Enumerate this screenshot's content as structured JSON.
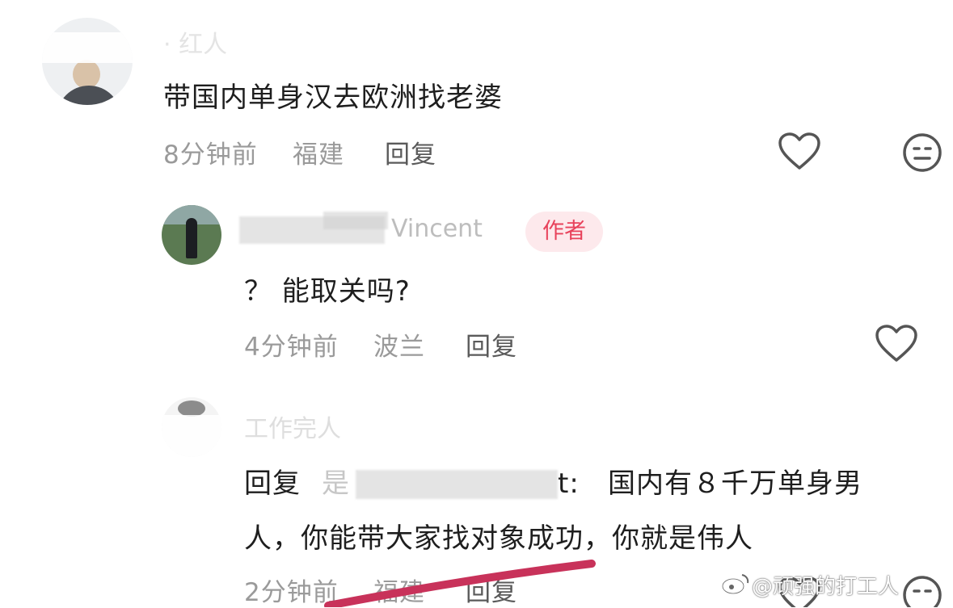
{
  "comments": [
    {
      "author": "· 红人",
      "text": "带国内单身汉去欧洲找老婆",
      "time": "8分钟前",
      "location": "福建",
      "reply_label": "回复"
    },
    {
      "author": "Vincent",
      "author_badge": "作者",
      "text": "？ 能取关吗?",
      "time": "4分钟前",
      "location": "波兰",
      "reply_label": "回复"
    },
    {
      "author": "工作完人",
      "reply_prefix": "回复",
      "reply_target": "是",
      "reply_target_tail": "t:",
      "text_line1": "国内有８千万单身男",
      "text_line2": "人，你能带大家找对象成功，你就是伟人",
      "time": "2分钟前",
      "location": "福建",
      "reply_label": "回复"
    }
  ],
  "watermark": "@顽强的打工人",
  "colors": {
    "badge_text": "#e8425b",
    "badge_bg": "#fde9ec",
    "red_stroke": "#c8325a"
  },
  "icons": [
    "heart-outline-icon",
    "dislike-face-icon",
    "weibo-logo-icon"
  ]
}
